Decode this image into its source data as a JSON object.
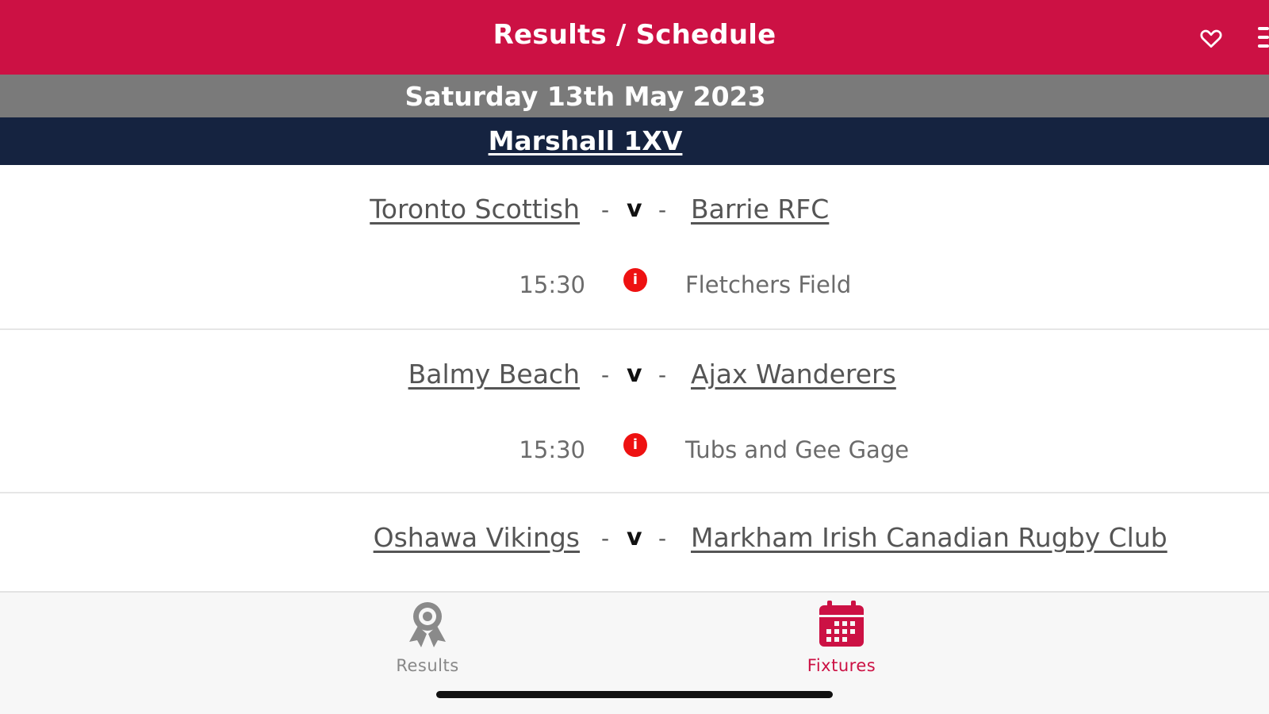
{
  "header": {
    "title": "Results / Schedule",
    "favorite_icon": "heart-outline-icon",
    "menu_icon": "hamburger-menu-icon",
    "accent_color": "#cc1144"
  },
  "date_header": {
    "label": "Saturday 13th May 2023"
  },
  "competition": {
    "label": "Marshall 1XV"
  },
  "fixtures": [
    {
      "home": "Toronto Scottish",
      "separator_left": "-",
      "versus": "v",
      "separator_right": "-",
      "away": "Barrie RFC",
      "time": "15:30",
      "info_icon_glyph": "i",
      "venue": "Fletchers Field"
    },
    {
      "home": "Balmy Beach",
      "separator_left": "-",
      "versus": "v",
      "separator_right": "-",
      "away": "Ajax Wanderers",
      "time": "15:30",
      "info_icon_glyph": "i",
      "venue": "Tubs and Gee Gage"
    },
    {
      "home": "Oshawa Vikings",
      "separator_left": "-",
      "versus": "v",
      "separator_right": "-",
      "away": "Markham Irish Canadian Rugby Club"
    }
  ],
  "tabbar": {
    "tabs": [
      {
        "label": "Results",
        "icon": "award-ribbon-icon",
        "active": false
      },
      {
        "label": "Fixtures",
        "icon": "calendar-icon",
        "active": true
      }
    ]
  }
}
